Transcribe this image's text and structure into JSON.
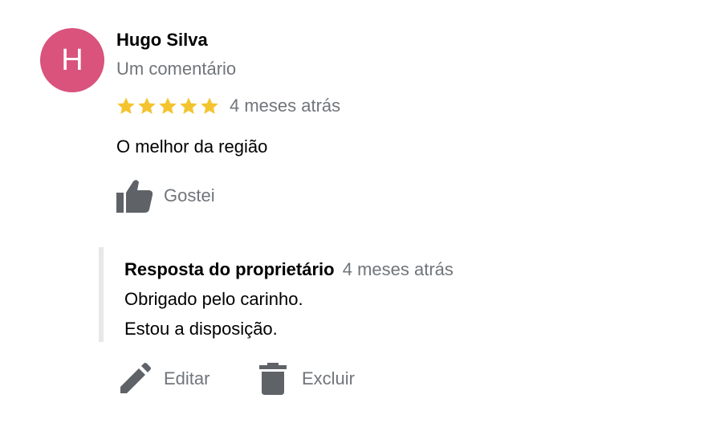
{
  "review": {
    "avatar_initial": "H",
    "avatar_color": "#d9537c",
    "author_name": "Hugo Silva",
    "author_meta": "Um comentário",
    "rating": 5,
    "rating_max": 5,
    "star_color": "#f4c430",
    "date": "4 meses atrás",
    "text": "O melhor da região",
    "like_label": "Gostei",
    "like_icon": "thumbs-up-icon"
  },
  "owner_reply": {
    "title": "Resposta do proprietário",
    "date": "4 meses atrás",
    "lines": [
      "Obrigado pelo carinho.",
      "Estou a disposição."
    ]
  },
  "actions": {
    "edit_label": "Editar",
    "edit_icon": "pencil-icon",
    "delete_label": "Excluir",
    "delete_icon": "trash-icon",
    "icon_color": "#5f6368"
  }
}
